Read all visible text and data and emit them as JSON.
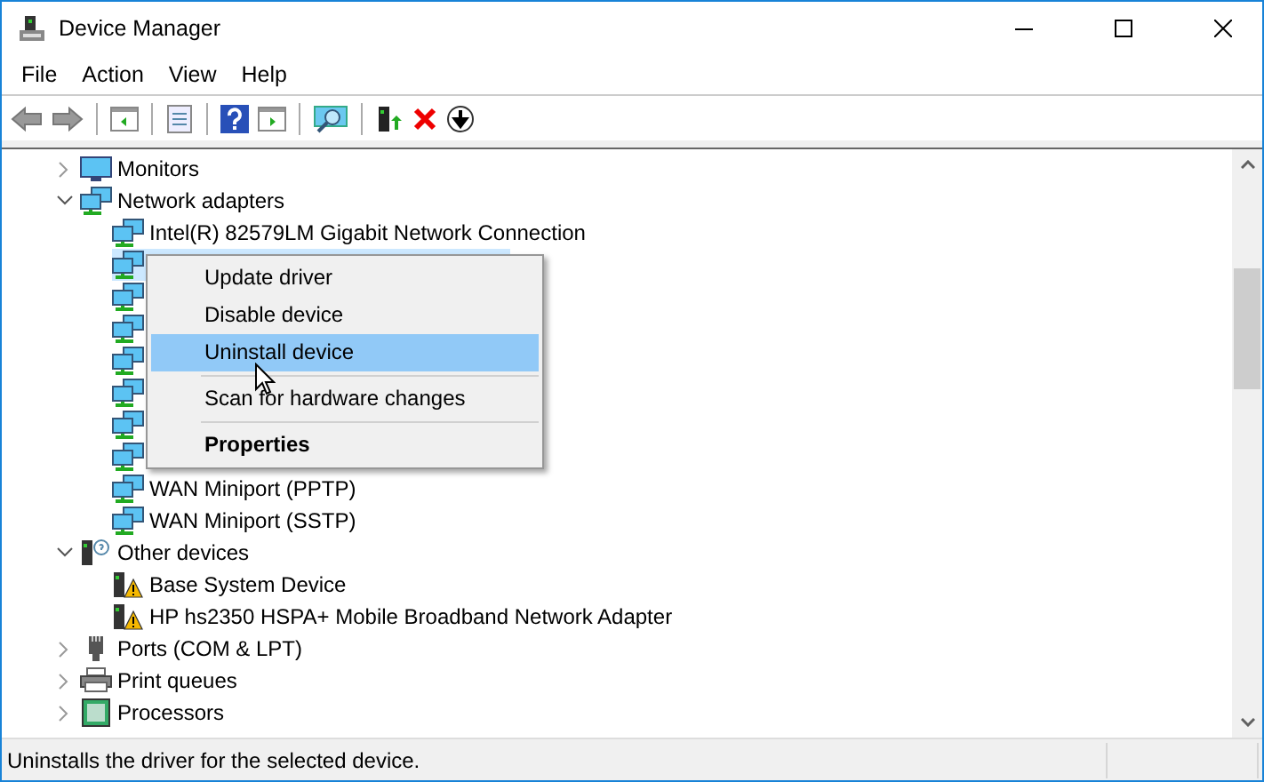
{
  "window": {
    "title": "Device Manager"
  },
  "menu": [
    "File",
    "Action",
    "View",
    "Help"
  ],
  "tree": [
    {
      "label": "Monitors",
      "kind": "monitor",
      "expanded": false
    },
    {
      "label": "Network adapters",
      "kind": "network",
      "expanded": true,
      "children": [
        {
          "label": "Intel(R) 82579LM Gigabit Network Connection",
          "kind": "network",
          "selected": false
        },
        {
          "kind": "network",
          "selected": true
        },
        {
          "kind": "network",
          "selected": false
        },
        {
          "kind": "network",
          "selected": false
        },
        {
          "kind": "network",
          "selected": false
        },
        {
          "kind": "network",
          "selected": false
        },
        {
          "kind": "network",
          "selected": false
        },
        {
          "kind": "network",
          "selected": false
        },
        {
          "label": "WAN Miniport (PPTP)",
          "kind": "network",
          "selected": false
        },
        {
          "label": "WAN Miniport (SSTP)",
          "kind": "network",
          "selected": false
        }
      ]
    },
    {
      "label": "Other devices",
      "kind": "other",
      "expanded": true,
      "children": [
        {
          "label": "Base System Device",
          "kind": "warning",
          "selected": false
        },
        {
          "label": "HP hs2350 HSPA+ Mobile Broadband Network Adapter",
          "kind": "warning",
          "selected": false
        }
      ]
    },
    {
      "label": "Ports (COM & LPT)",
      "kind": "port",
      "expanded": false
    },
    {
      "label": "Print queues",
      "kind": "printer",
      "expanded": false
    },
    {
      "label": "Processors",
      "kind": "processor",
      "expanded": false
    }
  ],
  "context_menu": [
    {
      "kind": "item",
      "label": "Update driver",
      "selected": false
    },
    {
      "kind": "item",
      "label": "Disable device",
      "selected": false
    },
    {
      "kind": "item",
      "label": "Uninstall device",
      "selected": true
    },
    {
      "kind": "separator"
    },
    {
      "kind": "item",
      "label": "Scan for hardware changes",
      "selected": false
    },
    {
      "kind": "separator"
    },
    {
      "kind": "default",
      "label": "Properties",
      "selected": false
    }
  ],
  "status_bar": "Uninstalls the driver for the selected device."
}
